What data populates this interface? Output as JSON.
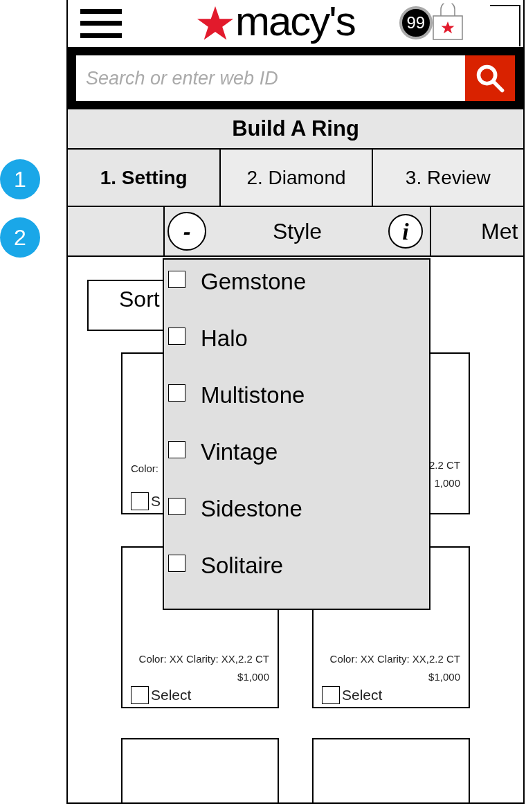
{
  "annotations": [
    {
      "label": "1"
    },
    {
      "label": "2"
    }
  ],
  "header": {
    "logo": "macy's",
    "cart_count": "99"
  },
  "search": {
    "placeholder": "Search or enter web ID"
  },
  "title": "Build A Ring",
  "steps": [
    {
      "label": "1. Setting",
      "selected": true
    },
    {
      "label": "2. Diamond",
      "selected": false
    },
    {
      "label": "3. Review",
      "selected": false
    }
  ],
  "filter_bar": {
    "style": {
      "label": "Style",
      "collapse": "-",
      "info": "i",
      "expanded": true
    },
    "next": "Met"
  },
  "style_options": [
    {
      "label": "Gemstone",
      "checked": false
    },
    {
      "label": "Halo",
      "checked": false
    },
    {
      "label": "Multistone",
      "checked": false
    },
    {
      "label": "Vintage",
      "checked": false
    },
    {
      "label": "Sidestone",
      "checked": false
    },
    {
      "label": "Solitaire",
      "checked": false
    }
  ],
  "sort": {
    "label": "Sort"
  },
  "products": [
    {
      "kind": "info",
      "spec": "Color:",
      "select": {
        "label": "S",
        "checked": false
      }
    },
    {
      "kind": "info",
      "spec": "2.2 CT",
      "price": "1,000"
    },
    {
      "kind": "info",
      "spec": "Color: XX Clarity: XX,2.2 CT",
      "price": "$1,000",
      "select": {
        "label": "Select",
        "checked": false
      }
    },
    {
      "kind": "info",
      "spec": "Color: XX Clarity: XX,2.2 CT",
      "price": "$1,000",
      "select": {
        "label": "Select",
        "checked": false
      }
    },
    {
      "kind": "blank"
    },
    {
      "kind": "blank"
    }
  ]
}
